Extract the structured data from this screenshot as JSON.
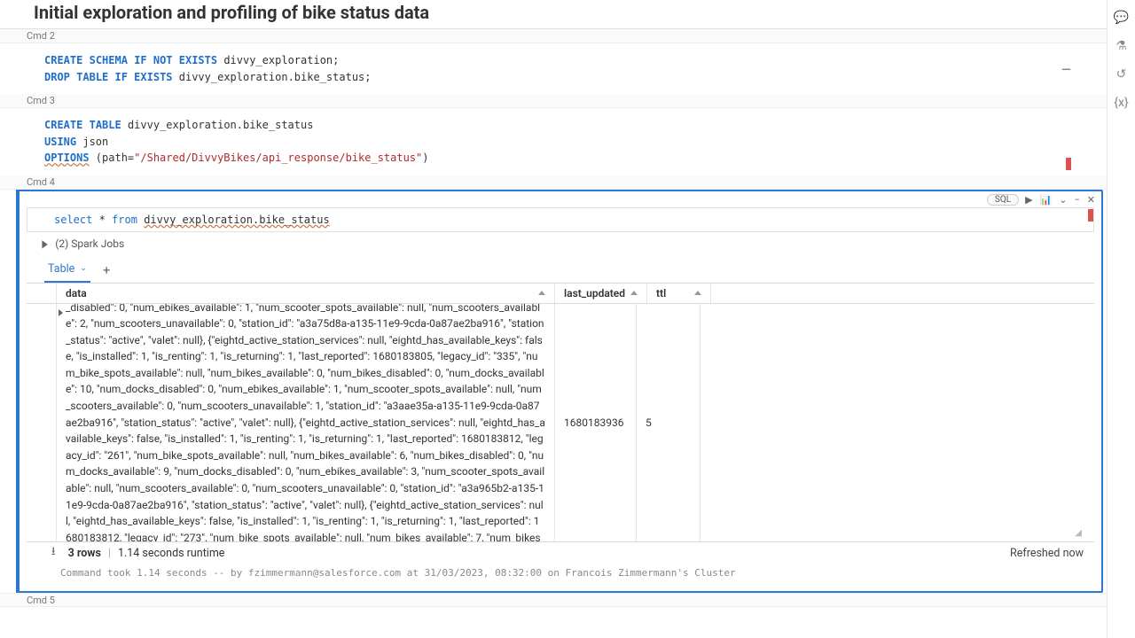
{
  "header": {
    "title": "Initial exploration and profiling of bike status data"
  },
  "cells": {
    "c2": {
      "label": "Cmd 2",
      "code_html": "<span class='kw'>CREATE</span> <span class='kw'>SCHEMA</span> <span class='kw'>IF NOT EXISTS</span> divvy_exploration;\n<span class='kw'>DROP</span> <span class='kw'>TABLE</span> <span class='kw'>IF EXISTS</span> divvy_exploration.bike_status;"
    },
    "c3": {
      "label": "Cmd 3",
      "code_html": "<span class='kw'>CREATE</span> <span class='kw'>TABLE</span> divvy_exploration.bike_status\n<span class='kw'>USING</span> json\n<span class='kw squig'>OPTIONS</span> (path=<span class='str'>\"/Shared/DivvyBikes/api_response/bike_status\"</span>)"
    },
    "c4": {
      "label": "Cmd 4",
      "sql_pill": "SQL",
      "code_html": "<span class='kw2'>select</span> * <span class='kw2'>from</span> <span class='squig'>divvy_exploration.bike_status</span>",
      "spark_jobs": "(2) Spark Jobs",
      "tab_label": "Table",
      "columns": {
        "data": "data",
        "last_updated": "last_updated",
        "ttl": "ttl"
      },
      "row": {
        "last_updated": "1680183936",
        "ttl": "5",
        "data": "{\"stations\": [{\"eightd_active_station_services\": null, \"eightd_has_available_keys\": false, \"is_installed\": 1, \"is_renting\": 1, \"is_returning\": 1, \"last_reported\": 1680183797, \"legacy_id\": \"184\", \"num_bike_spots_available\": null, \"num_bikes_available\": 3, \"num_bikes_disabled\": 0, \"num_docks_available\": 14, \"num_docks_disabled\": 0, \"num_ebikes_available\": 1, \"num_scooter_spots_available\": null, \"num_scooters_available\": 2, \"num_scooters_unavailable\": 0, \"station_id\": \"a3a75d8a-a135-11e9-9cda-0a87ae2ba916\", \"station_status\": \"active\", \"valet\": null}, {\"eightd_active_station_services\": null, \"eightd_has_available_keys\": false, \"is_installed\": 1, \"is_renting\": 1, \"is_returning\": 1, \"last_reported\": 1680183805, \"legacy_id\": \"335\", \"num_bike_spots_available\": null, \"num_bikes_available\": 0, \"num_bikes_disabled\": 0, \"num_docks_available\": 10, \"num_docks_disabled\": 0, \"num_ebikes_available\": 1, \"num_scooter_spots_available\": null, \"num_scooters_available\": 0, \"num_scooters_unavailable\": 1, \"station_id\": \"a3aae35a-a135-11e9-9cda-0a87ae2ba916\", \"station_status\": \"active\", \"valet\": null}, {\"eightd_active_station_services\": null, \"eightd_has_available_keys\": false, \"is_installed\": 1, \"is_renting\": 1, \"is_returning\": 1, \"last_reported\": 1680183812, \"legacy_id\": \"261\", \"num_bike_spots_available\": null, \"num_bikes_available\": 6, \"num_bikes_disabled\": 0, \"num_docks_available\": 9, \"num_docks_disabled\": 0, \"num_ebikes_available\": 3, \"num_scooter_spots_available\": null, \"num_scooters_available\": 0, \"num_scooters_unavailable\": 0, \"station_id\": \"a3a965b2-a135-11e9-9cda-0a87ae2ba916\", \"station_status\": \"active\", \"valet\": null}, {\"eightd_active_station_services\": null, \"eightd_has_available_keys\": false, \"is_installed\": 1, \"is_renting\": 1, \"is_returning\": 1, \"last_reported\": 1680183812, \"legacy_id\": \"273\", \"num_bike_spots_available\": null, \"num_bikes_available\": 7, \"num_bikes_disabled\": 0, \"num_docks_available\": 15, \"num_docks_disabled\": 0, \"num_ebikes_available\": 1, \"num_scooter_spots_available\": null, \"num_scooters_available\": 0, \"num_scooters_unavailable\": 0, \"station_id\": \"a3a99d47-a135-11e9-9cda-0a87ae2ba916\", \"station_status\": \"active\","
      },
      "footer": {
        "rows": "3 rows",
        "runtime": "1.14 seconds runtime",
        "refreshed": "Refreshed now",
        "status": "Command took 1.14 seconds -- by fzimmermann@salesforce.com at 31/03/2023, 08:32:00 on Francois Zimmermann's Cluster"
      }
    },
    "c5": {
      "label": "Cmd 5"
    }
  }
}
